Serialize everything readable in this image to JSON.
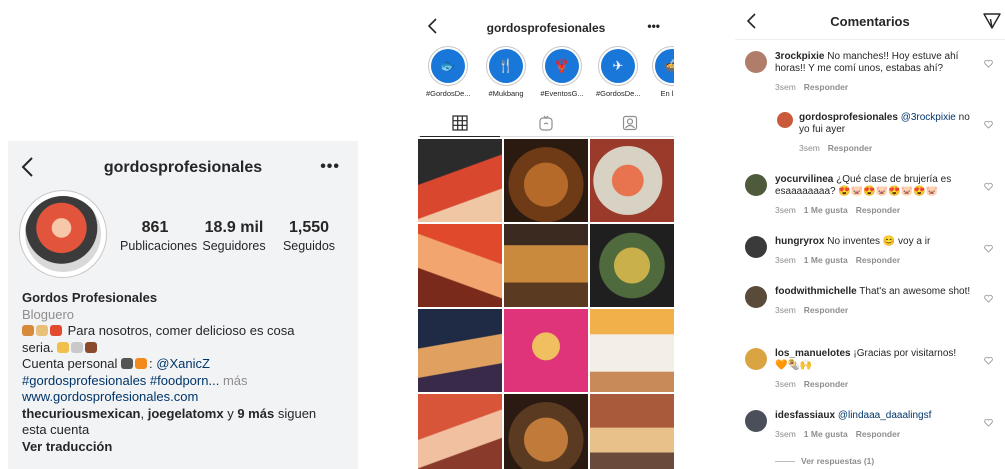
{
  "profile": {
    "username": "gordosprofesionales",
    "more_glyph": "•••",
    "stats": [
      {
        "count": "861",
        "label": "Publicaciones"
      },
      {
        "count": "18.9 mil",
        "label": "Seguidores"
      },
      {
        "count": "1,550",
        "label": "Seguidos"
      }
    ],
    "name": "Gordos Profesionales",
    "category": "Bloguero",
    "bio_line1": "Para nosotros, comer delicioso es cosa",
    "bio_line2": "seria.",
    "bio_line3_prefix": "Cuenta personal",
    "bio_line3_mention": "@XanicZ",
    "hashtags": "#gordosprofesionales #foodporn...",
    "more_label": "más",
    "website": "www.gordosprofesionales.com",
    "followed_by_1": "thecuriousmexican",
    "followed_by_2": "joegelatomx",
    "followed_by_y": "y",
    "followed_by_count": "9 más",
    "followed_by_suffix": "siguen",
    "followed_by_line2": "esta cuenta",
    "translate": "Ver traducción"
  },
  "feed": {
    "username": "gordosprofesionales",
    "more_glyph": "•••",
    "highlights": [
      {
        "label": "#GordosDe...",
        "icon": "seafood-icon"
      },
      {
        "label": "#Mukbang",
        "icon": "utensils-icon"
      },
      {
        "label": "#EventosG...",
        "icon": "lobster-icon"
      },
      {
        "label": "#GordosDe...",
        "icon": "airplane-icon"
      },
      {
        "label": "En la c",
        "icon": "food-bowl-icon"
      }
    ],
    "tabs": [
      "grid-icon",
      "igtv-icon",
      "tagged-icon"
    ],
    "tile_colors": [
      "#d9472f",
      "#7a4a21",
      "#c0513a",
      "#e0763a",
      "#8a5a2a",
      "#4f5a3c",
      "#2f3a55",
      "#e0347a",
      "#c9a06b",
      "#b8492c",
      "#6e4c2a",
      "#9a5b3b"
    ]
  },
  "comments": {
    "title": "Comentarios",
    "view_replies": "Ver respuestas (1)",
    "items": [
      {
        "user": "3rockpixie",
        "text": "No manches!! Hoy estuve ahí horas!! Y me comí unos, estabas ahí?",
        "time": "3sem",
        "likes": "",
        "reply": "Responder",
        "avatar_color": "#b07d6a"
      },
      {
        "user": "gordosprofesionales",
        "mention": "@3rockpixie",
        "text": "no yo fui ayer",
        "time": "3sem",
        "likes": "",
        "reply": "Responder",
        "avatar_color": "#c95a3c"
      },
      {
        "user": "yocurvilinea",
        "text": "¿Qué clase de brujería es esaaaaaaaa?",
        "emoji": "😍🐷😍🐷😍🐷😍🐷",
        "time": "3sem",
        "likes": "1 Me gusta",
        "reply": "Responder",
        "avatar_color": "#4d5b3c"
      },
      {
        "user": "hungryrox",
        "text": "No inventes 😊 voy a ir",
        "time": "3sem",
        "likes": "1 Me gusta",
        "reply": "Responder",
        "avatar_color": "#3a3a3a"
      },
      {
        "user": "foodwithmichelle",
        "text": "That's an awesome shot!",
        "time": "3sem",
        "likes": "",
        "reply": "Responder",
        "avatar_color": "#5a4a3a"
      },
      {
        "user": "los_manuelotes",
        "text": "¡Gracias por visitarnos!",
        "emoji": "🧡🌯🙌",
        "time": "3sem",
        "likes": "",
        "reply": "Responder",
        "avatar_color": "#d9a441"
      },
      {
        "user": "idesfassiaux",
        "mention": "@lindaaa_daaalingsf",
        "text": "",
        "time": "3sem",
        "likes": "1 Me gusta",
        "reply": "Responder",
        "avatar_color": "#4a4f5a"
      }
    ]
  }
}
